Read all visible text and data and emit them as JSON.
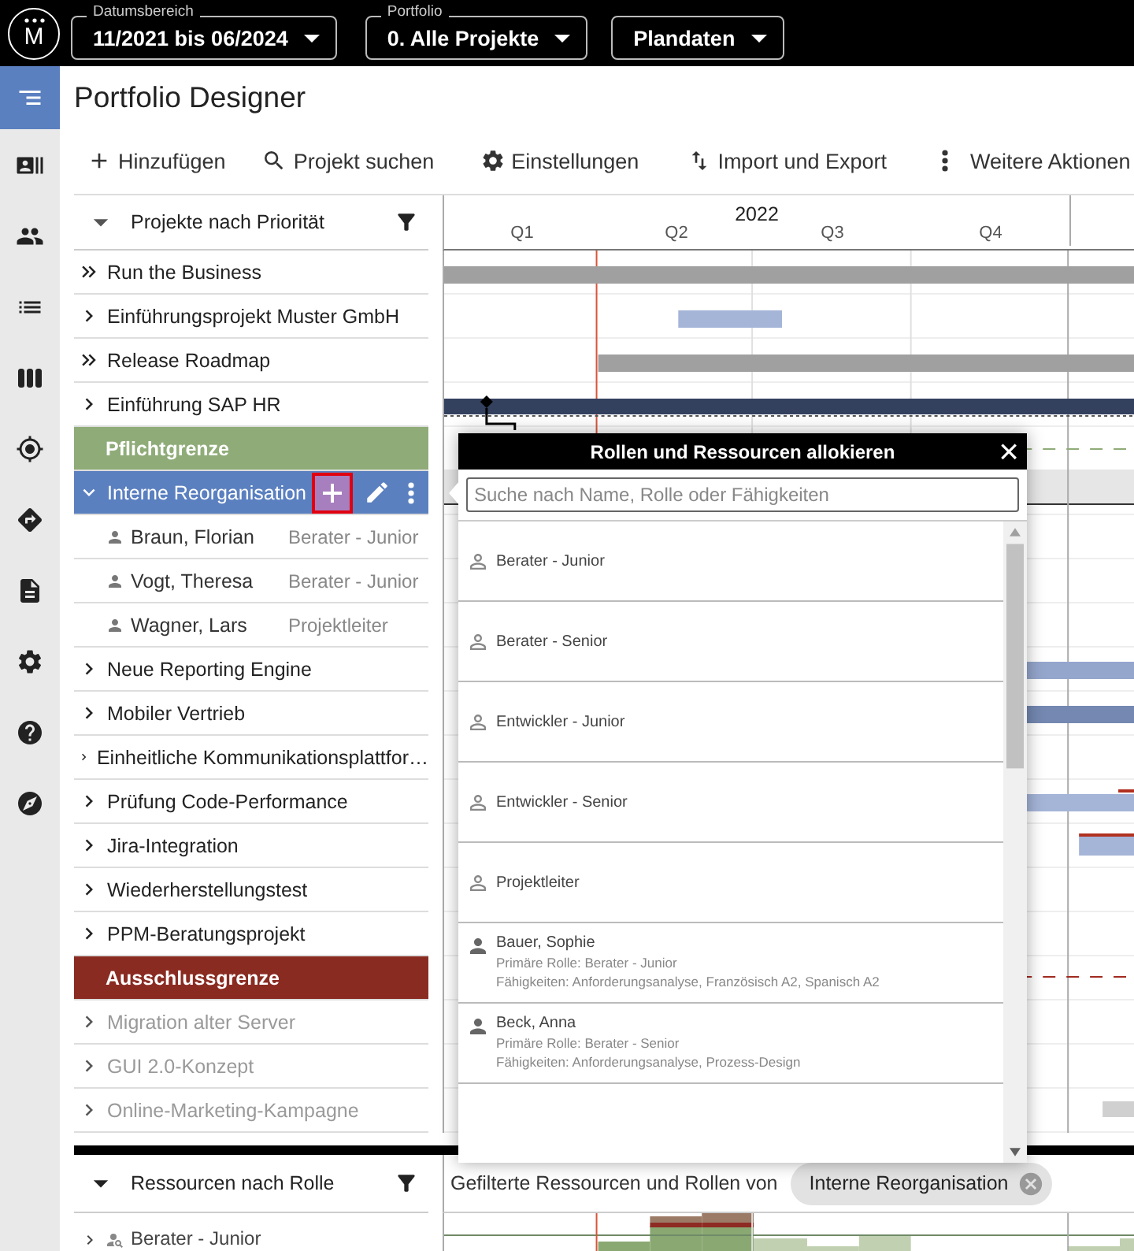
{
  "app_bar": {
    "logo": "M",
    "filters": [
      {
        "label": "Datumsbereich",
        "value": "11/2021 bis 06/2024"
      },
      {
        "label": "Portfolio",
        "value": "0. Alle Projekte"
      },
      {
        "value": "Plandaten"
      }
    ]
  },
  "nav": [
    {
      "selected": true
    },
    {
      "selected": false
    },
    {
      "selected": false
    },
    {
      "selected": false
    },
    {
      "selected": false
    },
    {
      "selected": false
    },
    {
      "selected": false
    },
    {
      "selected": false
    },
    {
      "selected": false
    },
    {
      "selected": false
    },
    {
      "selected": false
    }
  ],
  "page_title": "Portfolio Designer",
  "toolbar": [
    {
      "label": "Hinzufügen"
    },
    {
      "label": "Projekt suchen"
    },
    {
      "label": "Einstellungen"
    },
    {
      "label": "Import und Export"
    },
    {
      "label": "Weitere Aktionen"
    }
  ],
  "projects": {
    "title": "Projekte nach Priorität",
    "rows": [
      {
        "kind": "group",
        "label": "Run the Business",
        "expanded": false,
        "selected": false,
        "disabled": false
      },
      {
        "kind": "project",
        "label": "Einführungsprojekt Muster GmbH",
        "expanded": false,
        "selected": false,
        "disabled": false
      },
      {
        "kind": "group",
        "label": "Release Roadmap",
        "expanded": false,
        "selected": false,
        "disabled": false
      },
      {
        "kind": "project",
        "label": "Einführung SAP HR",
        "expanded": false,
        "selected": false,
        "disabled": false
      },
      {
        "kind": "boundary",
        "label": "Pflichtgrenze",
        "color": "#8fac78"
      },
      {
        "kind": "project",
        "label": "Interne Reorganisation",
        "expanded": true,
        "selected": true,
        "disabled": false
      },
      {
        "kind": "resource",
        "label": "Braun, Florian",
        "role": "Berater - Junior"
      },
      {
        "kind": "resource",
        "label": "Vogt, Theresa",
        "role": "Berater - Junior"
      },
      {
        "kind": "resource",
        "label": "Wagner, Lars",
        "role": "Projektleiter"
      },
      {
        "kind": "project",
        "label": "Neue Reporting Engine",
        "expanded": false,
        "selected": false,
        "disabled": false
      },
      {
        "kind": "project",
        "label": "Mobiler Vertrieb",
        "expanded": false,
        "selected": false,
        "disabled": false
      },
      {
        "kind": "project",
        "label": "Einheitliche Kommunikationsplattfor…",
        "expanded": false,
        "selected": false,
        "disabled": false
      },
      {
        "kind": "project",
        "label": "Prüfung Code-Performance",
        "expanded": false,
        "selected": false,
        "disabled": false
      },
      {
        "kind": "project",
        "label": "Jira-Integration",
        "expanded": false,
        "selected": false,
        "disabled": false
      },
      {
        "kind": "project",
        "label": "Wiederherstellungstest",
        "expanded": false,
        "selected": false,
        "disabled": false
      },
      {
        "kind": "project",
        "label": "PPM-Beratungsprojekt",
        "expanded": false,
        "selected": false,
        "disabled": false
      },
      {
        "kind": "boundary",
        "label": "Ausschlussgrenze",
        "color": "#8a2b22"
      },
      {
        "kind": "project",
        "label": "Migration alter Server",
        "expanded": false,
        "selected": false,
        "disabled": true
      },
      {
        "kind": "project",
        "label": "GUI 2.0-Konzept",
        "expanded": false,
        "selected": false,
        "disabled": true
      },
      {
        "kind": "project",
        "label": "Online-Marketing-Kampagne",
        "expanded": false,
        "selected": false,
        "disabled": true
      }
    ]
  },
  "timeline": {
    "year": "2022",
    "quarters": [
      "Q1",
      "Q2",
      "Q3",
      "Q4"
    ]
  },
  "allocation_dialog": {
    "title": "Rollen und Ressourcen allokieren",
    "close": "×",
    "search": {
      "placeholder": "Suche nach Name, Rolle oder Fähigkeiten"
    },
    "items": [
      {
        "kind": "role",
        "name": "Berater - Junior"
      },
      {
        "kind": "role",
        "name": "Berater - Senior"
      },
      {
        "kind": "role",
        "name": "Entwickler - Junior"
      },
      {
        "kind": "role",
        "name": "Entwickler - Senior"
      },
      {
        "kind": "role",
        "name": "Projektleiter"
      },
      {
        "kind": "person",
        "name": "Bauer, Sophie",
        "primary_role": "Primäre Rolle: Berater - Junior",
        "skills": "Fähigkeiten: Anforderungsanalyse, Französisch A2, Spanisch A2"
      },
      {
        "kind": "person",
        "name": "Beck, Anna",
        "primary_role": "Primäre Rolle: Berater - Senior",
        "skills": "Fähigkeiten: Anforderungsanalyse, Prozess-Design"
      }
    ]
  },
  "resources": {
    "title": "Ressourcen nach Rolle",
    "rows": [
      {
        "label": "Berater - Junior",
        "expanded": false
      }
    ]
  },
  "filter_bar": {
    "label": "Gefilterte Ressourcen und Rollen von",
    "chip": "Interne Reorganisation"
  }
}
